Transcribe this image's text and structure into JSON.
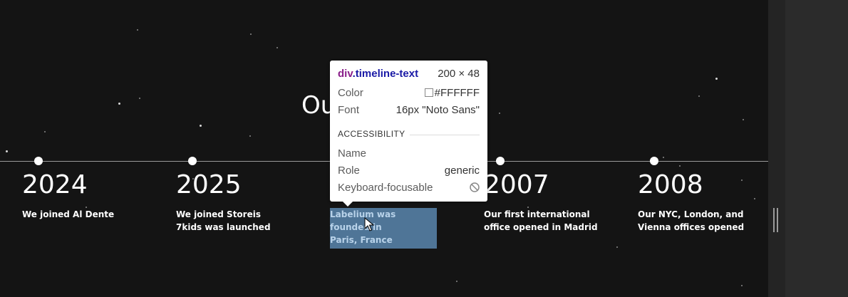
{
  "page": {
    "heading_partial": "Ou",
    "timeline": [
      {
        "year": "2024",
        "text_lines": [
          "We joined Al Dente"
        ]
      },
      {
        "year": "2025",
        "text_lines": [
          "We joined Storeis",
          "7kids was launched"
        ]
      },
      {
        "year": "",
        "text_lines": [
          "Labelium was founded in",
          "Paris, France"
        ],
        "highlighted": true
      },
      {
        "year": "2007",
        "text_lines": [
          "Our first international",
          "office opened in Madrid"
        ]
      },
      {
        "year": "2008",
        "text_lines": [
          "Our NYC, London, and",
          "Vienna offices opened"
        ]
      }
    ]
  },
  "inspector": {
    "tag": "div",
    "class": ".timeline-text",
    "size": "200 × 48",
    "color_label": "Color",
    "color_value": "#FFFFFF",
    "font_label": "Font",
    "font_value": "16px \"Noto Sans\"",
    "section_title": "ACCESSIBILITY",
    "name_label": "Name",
    "name_value": "",
    "role_label": "Role",
    "role_value": "generic",
    "focusable_label": "Keyboard-focusable",
    "focusable_icon": "not-allowed-icon"
  },
  "colors": {
    "background": "#141414",
    "highlight": "#4f7597",
    "tag": "#8a1f8a",
    "class": "#1a1aa6"
  }
}
